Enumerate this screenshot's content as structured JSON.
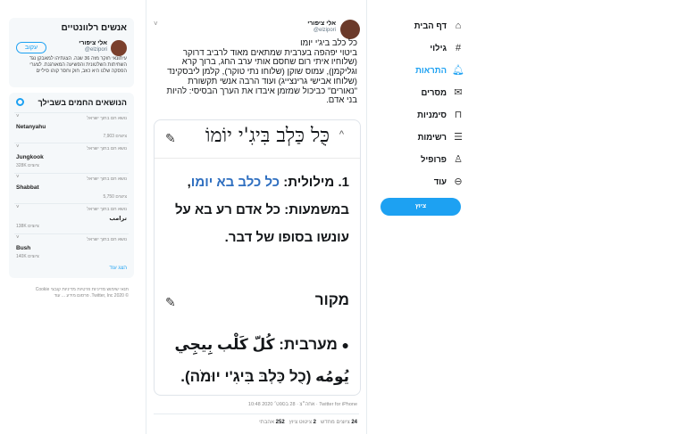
{
  "who_to_follow": {
    "header": "אנשים רלוונטיים",
    "user_name": "אלי ציפורי",
    "user_handle": "@elzipori",
    "follow_label": "עקוב",
    "bio": "עיתונאי חוקר מזה 36 שנה. הצגתיהו למאבקן נגד השחיתות השלטונית והפשיעה המאורגנת. לצערי הפסקה שלנו היא כוזב, חוק וחסר קוהו סיליים"
  },
  "trends": {
    "header": "הנושאים החמים בשבילך",
    "more_label": "הצג עוד",
    "items": [
      {
        "context": "נושא חם בתוך ישראל",
        "name": "Netanyahu",
        "count": "7,903 ציוצים"
      },
      {
        "context": "נושא חם בתוך ישראל",
        "name": "Jungkook",
        "count": "328K ציוצים"
      },
      {
        "context": "נושא חם בתוך ישראל",
        "name": "Shabbat",
        "count": "5,750 ציוצים"
      },
      {
        "context": "נושא חם בתוך ישראל",
        "name": "ترامب",
        "count": "138K ציוצים"
      },
      {
        "context": "נושא חם בתוך ישראל",
        "name": "Bush",
        "count": "140K ציוצים"
      }
    ]
  },
  "footer": {
    "line1": "תנאי שימוש  מדיניות פרטיות  מדיניות קובצי Cookie",
    "line2": "© 2020 Twitter, Inc.  פרסום מידע ...  עוד"
  },
  "tweet": {
    "author_name": "אלי ציפורי",
    "author_handle": "@elzipori",
    "text": "כל כלב ביג'י יומו\nביטוי יפהפה בערבית שמתאים מאוד לרביב דרוקר (שלוחיו איתי רום שחסם אותי ערב החג, ברוך קרא וגליקמן), עמוס שוקן (שלוחו נתי טוקר), קלמן ליבסקינד (שלוחו אבישי גרינצייג) ועוד הרבה אנשי תקשורת \"נאורים\" כביכול שמזמן איבדו את הערך הבסיסי: להיות בני אדם.",
    "card_title": "כֻּל כַּלְב בִּיגִ'י יוֹמוֹ",
    "definition_prefix": "1.  מילולית: ",
    "definition_highlight": "כל כלב בא יומו",
    "definition_rest": ", במשמעות: כל אדם רע בא על עונשו בסופו של דבר.",
    "source_heading": "מקור",
    "arabic_lead": "מערבית: ",
    "arabic_text": "كُلّ كَلْب بِيجِي يُومُه",
    "arabic_translit": " (כֻל כַּלְבּ בִּיגִ'י יוּמֹה).",
    "meta": "10:48 אחה״צ · 28 בספט׳ 2020 · Twitter for iPhone",
    "retweets": "24",
    "retweets_label": "ציוצים מחדש",
    "quotes": "2",
    "quotes_label": "ציטוט ציוץ",
    "likes": "252",
    "likes_label": "אהבתי"
  },
  "nav": {
    "items": [
      {
        "label": "דף הבית",
        "icon": "home-icon"
      },
      {
        "label": "גילוי",
        "icon": "hash-icon"
      },
      {
        "label": "התראות",
        "icon": "bell-icon"
      },
      {
        "label": "מסרים",
        "icon": "mail-icon"
      },
      {
        "label": "סימניות",
        "icon": "bookmark-icon"
      },
      {
        "label": "רשימות",
        "icon": "list-icon"
      },
      {
        "label": "פרופיל",
        "icon": "person-icon"
      },
      {
        "label": "עוד",
        "icon": "more-icon"
      }
    ],
    "tweet_button": "ציוץ"
  },
  "colors": {
    "accent": "#1da1f2",
    "link": "#2f6fc0"
  }
}
